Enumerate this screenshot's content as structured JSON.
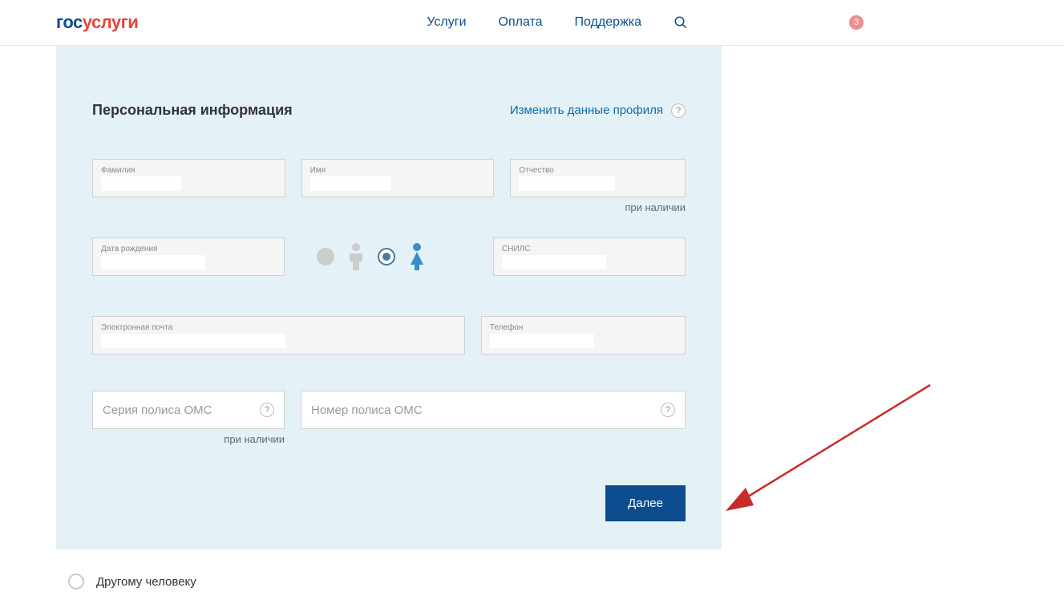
{
  "header": {
    "logo_part1": "гос",
    "logo_part2": "услуги",
    "nav": {
      "services": "Услуги",
      "payment": "Оплата",
      "support": "Поддержка"
    },
    "notification_count": "3"
  },
  "form": {
    "section_title": "Персональная информация",
    "edit_profile_link": "Изменить данные профиля",
    "fields": {
      "lastname": {
        "label": "Фамилия",
        "value": ""
      },
      "firstname": {
        "label": "Имя",
        "value": ""
      },
      "patronymic": {
        "label": "Отчество",
        "value": "",
        "helper": "при наличии"
      },
      "dob": {
        "label": "Дата рождения",
        "value": ""
      },
      "snils": {
        "label": "СНИЛС",
        "value": ""
      },
      "email": {
        "label": "Электронная почта",
        "value": ""
      },
      "phone": {
        "label": "Телефон",
        "value": ""
      },
      "oms_series": {
        "placeholder": "Серия полиса ОМС",
        "helper": "при наличии"
      },
      "oms_number": {
        "placeholder": "Номер полиса ОМС"
      }
    },
    "gender_selected": "female",
    "next_button": "Далее"
  },
  "other_person_option": "Другому человеку"
}
